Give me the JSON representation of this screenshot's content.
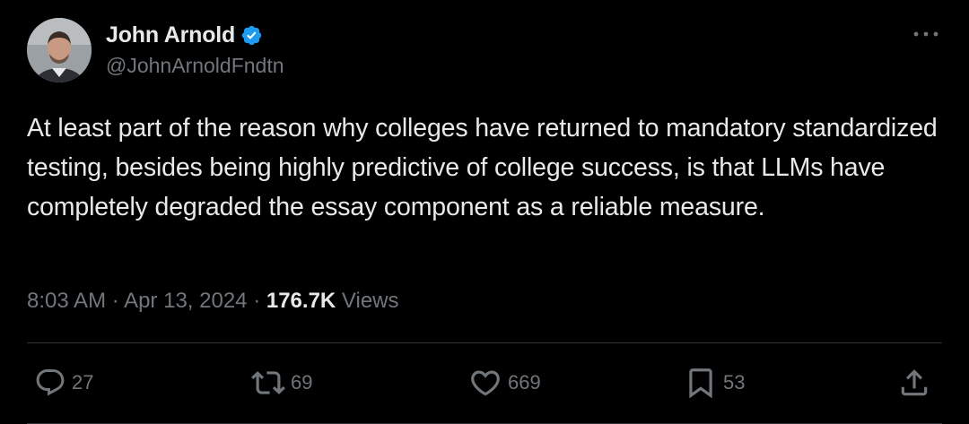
{
  "author": {
    "display_name": "John Arnold",
    "handle": "@JohnArnoldFndtn",
    "verified": true,
    "verified_color": "#1d9bf0"
  },
  "menu": {
    "icon": "more-horizontal-icon"
  },
  "tweet": {
    "text": "At least part of the reason why colleges have returned to mandatory standardized testing, besides being highly predictive of college success, is that LLMs have completely degraded the essay component as a reliable measure."
  },
  "meta": {
    "time": "8:03 AM",
    "separator": "·",
    "date": "Apr 13, 2024",
    "views_count": "176.7K",
    "views_label": "Views"
  },
  "actions": {
    "reply": {
      "icon": "reply-icon",
      "count": "27"
    },
    "retweet": {
      "icon": "retweet-icon",
      "count": "69"
    },
    "like": {
      "icon": "heart-icon",
      "count": "669"
    },
    "bookmark": {
      "icon": "bookmark-icon",
      "count": "53"
    },
    "share": {
      "icon": "share-icon"
    }
  },
  "colors": {
    "background": "#000000",
    "text_primary": "#e7e9ea",
    "text_secondary": "#71767b",
    "divider": "#2f3336"
  }
}
